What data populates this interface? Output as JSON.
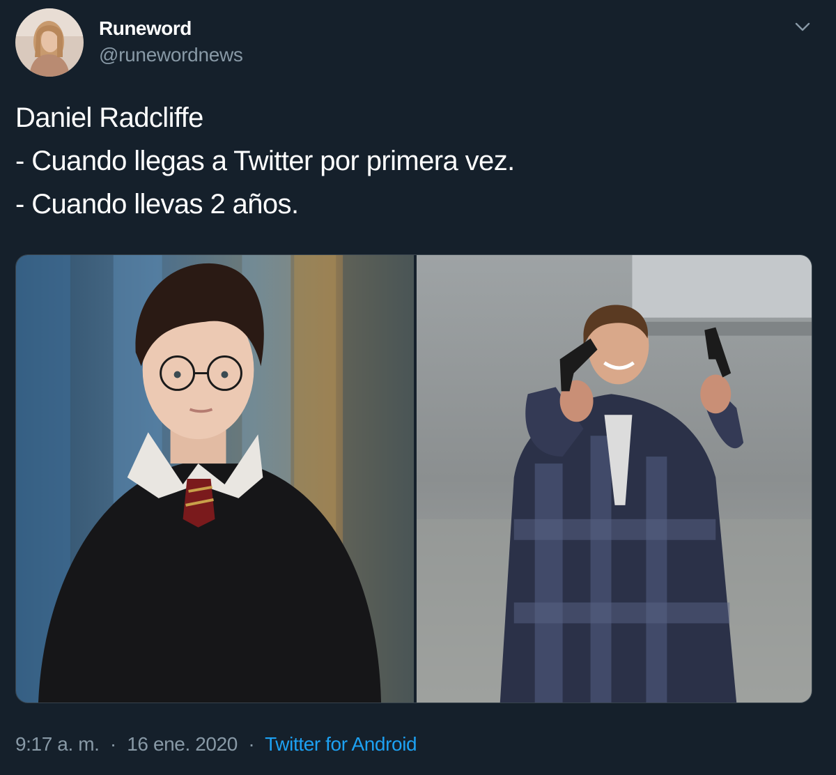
{
  "author": {
    "display_name": "Runeword",
    "handle": "@runewordnews"
  },
  "tweet": {
    "lines": [
      "Daniel Radcliffe",
      "- Cuando llegas a Twitter por primera vez.",
      "- Cuando llevas 2 años."
    ]
  },
  "footer": {
    "time": "9:17 a. m.",
    "separator": "·",
    "date": "16 ene. 2020",
    "source": "Twitter for Android"
  },
  "icons": {
    "more": "chevron-down-icon"
  },
  "colors": {
    "background": "#15202b",
    "secondary_text": "#8899a6",
    "link": "#1da1f2"
  }
}
